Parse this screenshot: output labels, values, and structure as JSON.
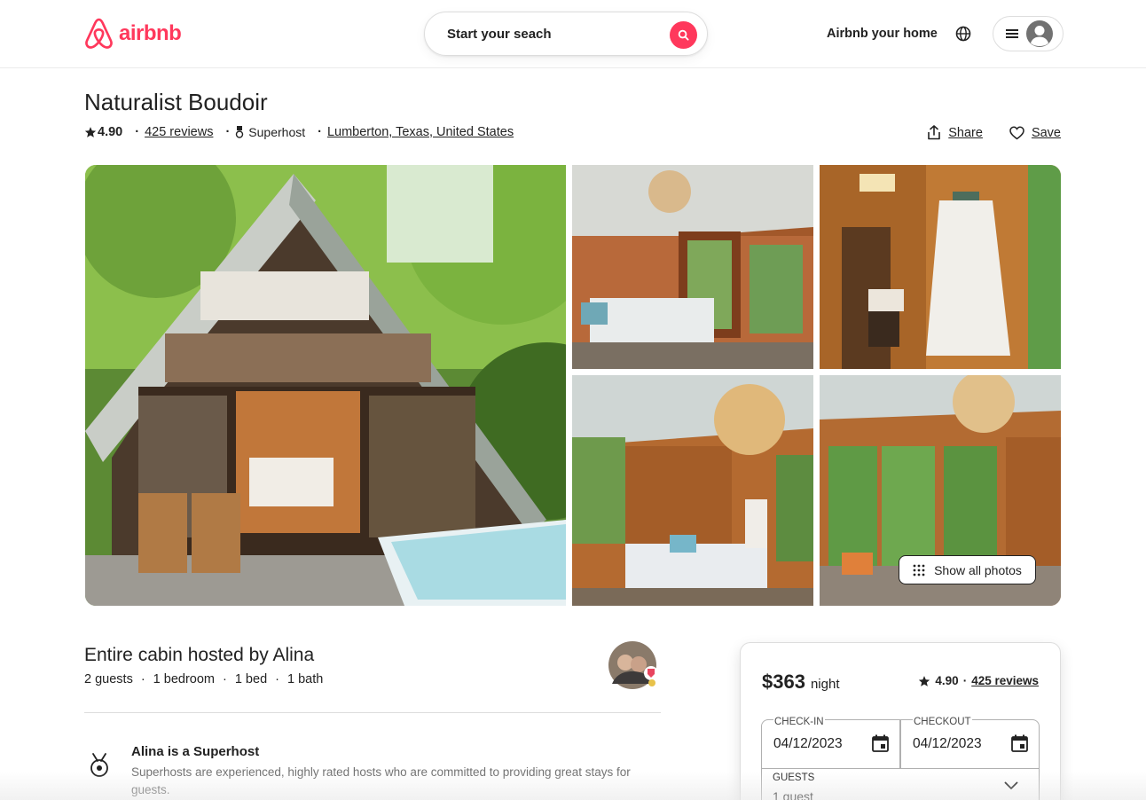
{
  "brand": {
    "name": "airbnb",
    "color": "#ff385c"
  },
  "header": {
    "search_label": "Start your seach",
    "host_link": "Airbnb your home",
    "icons": [
      "airbnb-logo-icon",
      "search-icon",
      "globe-icon",
      "menu-icon",
      "user-avatar-icon"
    ]
  },
  "listing": {
    "title": "Naturalist Boudoir",
    "rating": "4.90",
    "reviews": "425 reviews",
    "superhost": "Superhost",
    "location": "Lumberton, Texas, United States",
    "share_label": "Share",
    "save_label": "Save"
  },
  "gallery": {
    "show_all_label": "Show all photos"
  },
  "host": {
    "title": "Entire cabin hosted by Alina",
    "details": [
      "2 guests",
      "1 bedroom",
      "1 bed",
      "1 bath"
    ],
    "superhost_title": "Alina is a Superhost",
    "superhost_desc": "Superhosts are experienced, highly rated hosts who are committed to providing great stays for guests."
  },
  "booking": {
    "price": "$363",
    "price_unit": "night",
    "rating": "4.90",
    "reviews": "425 reviews",
    "checkin_label": "CHECK-IN",
    "checkin_value": "04/12/2023",
    "checkout_label": "CHECKOUT",
    "checkout_value": "04/12/2023",
    "guests_label": "GUESTS",
    "guests_value": "1 guest"
  }
}
